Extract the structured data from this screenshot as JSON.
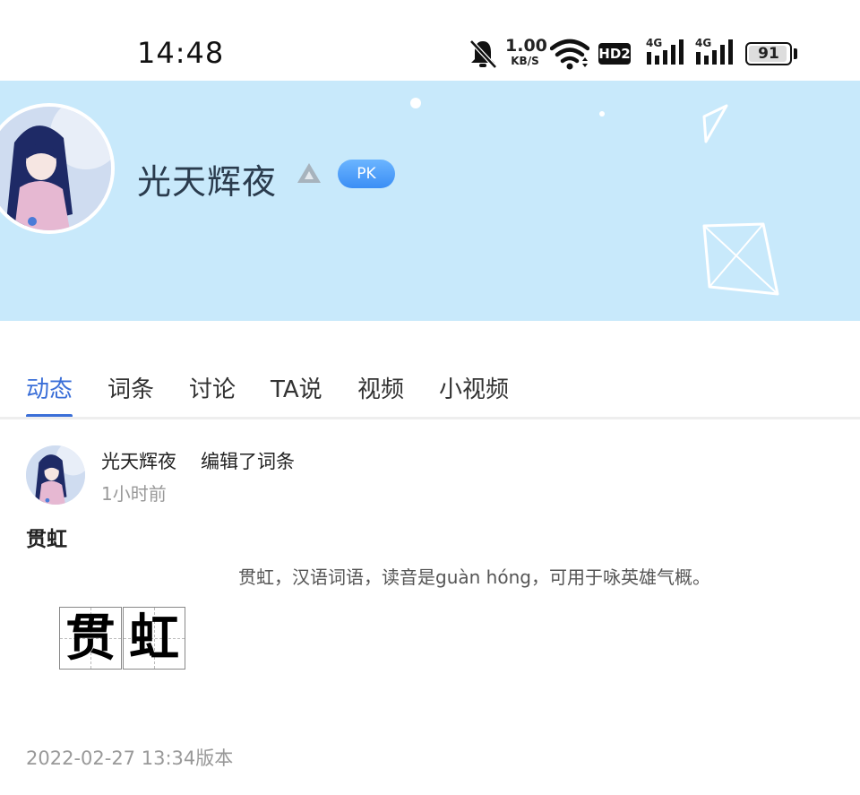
{
  "status_bar": {
    "time": "14:48",
    "speed_value": "1.00",
    "speed_unit": "KB/S",
    "hd_label": "HD2",
    "network_1": "4G",
    "network_2": "4G",
    "battery_percent": "91",
    "icons": [
      "bell-muted-icon",
      "wifi-icon",
      "hd-icon",
      "signal-icon",
      "signal-icon",
      "battery-icon"
    ]
  },
  "profile": {
    "name": "光天辉夜",
    "badge": "PK",
    "icons": [
      "level-triangle-icon"
    ]
  },
  "tabs": [
    {
      "label": "动态",
      "active": true
    },
    {
      "label": "词条",
      "active": false
    },
    {
      "label": "讨论",
      "active": false
    },
    {
      "label": "TA说",
      "active": false
    },
    {
      "label": "视频",
      "active": false
    },
    {
      "label": "小视频",
      "active": false
    }
  ],
  "post": {
    "user": "光天辉夜",
    "action": "编辑了词条",
    "time": "1小时前",
    "entry_title": "贯虹",
    "entry_desc": "贯虹，汉语词语，读音是guàn hóng，可用于咏英雄气概。",
    "characters": [
      "贯",
      "虹"
    ],
    "version": "2022-02-27 13:34版本"
  },
  "colors": {
    "banner": "#c8e9fb",
    "accent": "#3b6fd8",
    "pk_badge": "#3b8ef5"
  }
}
